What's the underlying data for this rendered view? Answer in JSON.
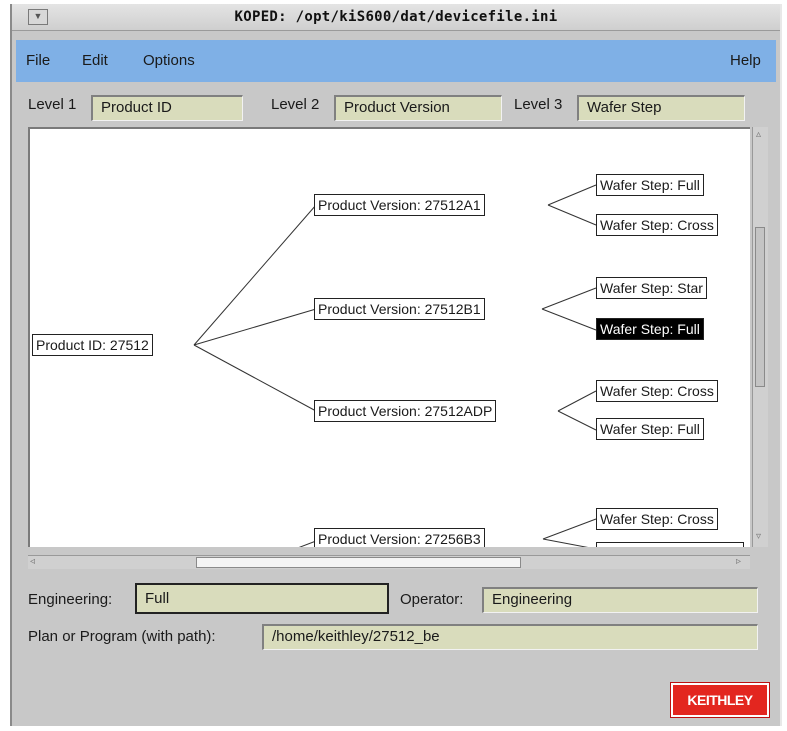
{
  "window": {
    "title": "KOPED: /opt/kiS600/dat/devicefile.ini"
  },
  "menubar": {
    "file": "File",
    "edit": "Edit",
    "options": "Options",
    "help": "Help"
  },
  "levels": {
    "level1_label": "Level 1",
    "level1_value": "Product ID",
    "level2_label": "Level 2",
    "level2_value": "Product Version",
    "level3_label": "Level 3",
    "level3_value": "Wafer Step"
  },
  "tree": {
    "root": "Product ID: 27512",
    "versions": [
      {
        "label": "Product Version: 27512A1",
        "steps": [
          "Wafer Step: Full",
          "Wafer Step: Cross"
        ]
      },
      {
        "label": "Product Version: 27512B1",
        "steps": [
          "Wafer Step: Star",
          "Wafer Step: Full"
        ]
      },
      {
        "label": "Product Version: 27512ADP",
        "steps": [
          "Wafer Step: Cross",
          "Wafer Step: Full"
        ]
      },
      {
        "label": "Product Version: 27256B3",
        "steps": [
          "Wafer Step: Cross",
          ""
        ]
      }
    ],
    "selected": "Wafer Step: Full"
  },
  "fields": {
    "engineering_label": "Engineering:",
    "engineering_value": "Full",
    "operator_label": "Operator:",
    "operator_value": "Engineering",
    "plan_label": "Plan or Program (with path):",
    "plan_value": "/home/keithley/27512_be"
  },
  "logo": {
    "text": "KEITHLEY",
    "color": "#e3261f"
  },
  "colors": {
    "menubar": "#7fb0e6",
    "field_bg": "#d9dcbc",
    "selected_node": "#000000"
  }
}
